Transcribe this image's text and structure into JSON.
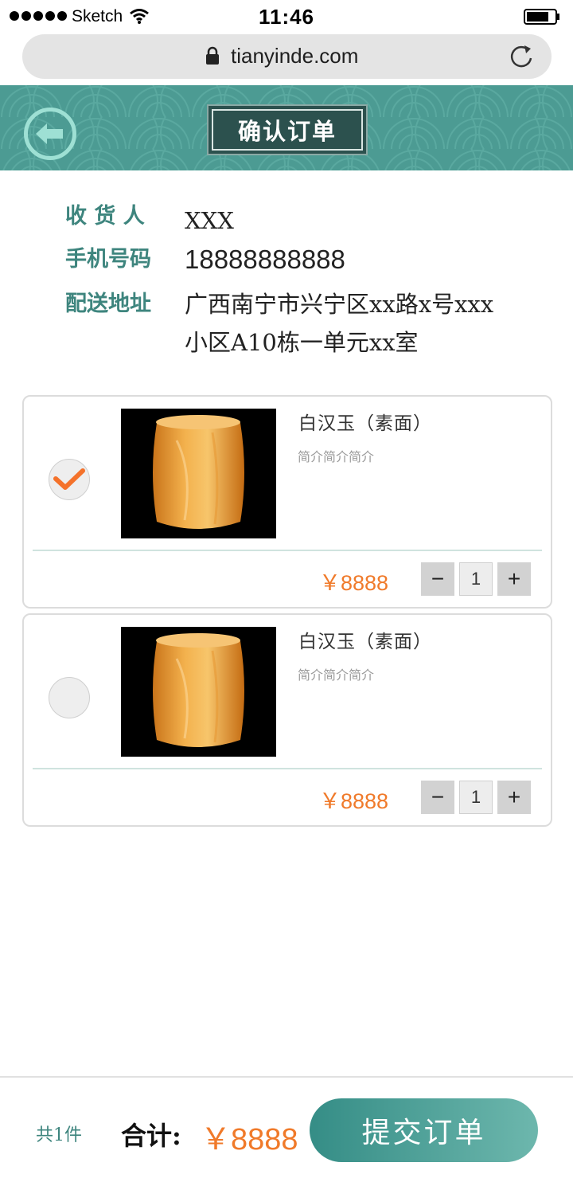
{
  "status_bar": {
    "carrier": "Sketch",
    "time": "11:46"
  },
  "browser": {
    "url": "tianyinde.com"
  },
  "header": {
    "title": "确认订单"
  },
  "recipient": {
    "name_label": "收 货 人",
    "name_value": "XXX",
    "phone_label": "手机号码",
    "phone_value": "18888888888",
    "address_label": "配送地址",
    "address_line1": "广西南宁市兴宁区xx路x号xxx",
    "address_line2": "小区A10栋一单元xx室"
  },
  "products": [
    {
      "name": "白汉玉（素面）",
      "desc": "简介简介简介",
      "price": "￥8888",
      "qty": "1",
      "selected": true
    },
    {
      "name": "白汉玉（素面）",
      "desc": "简介简介简介",
      "price": "￥8888",
      "qty": "1",
      "selected": false
    }
  ],
  "qty_controls": {
    "minus": "−",
    "plus": "+"
  },
  "footer": {
    "count": "共1件",
    "total_label": "合计:",
    "total_value": "￥8888",
    "submit_label": "提交订单"
  },
  "colors": {
    "teal": "#4c9b93",
    "teal_text": "#3e857e",
    "price_orange": "#f07a2a",
    "check_orange": "#f4722b"
  },
  "icons": {
    "back": "back-arrow-icon",
    "lock": "lock-icon",
    "reload": "reload-icon",
    "wifi": "wifi-icon",
    "battery": "battery-icon",
    "check": "checkmark-icon"
  }
}
